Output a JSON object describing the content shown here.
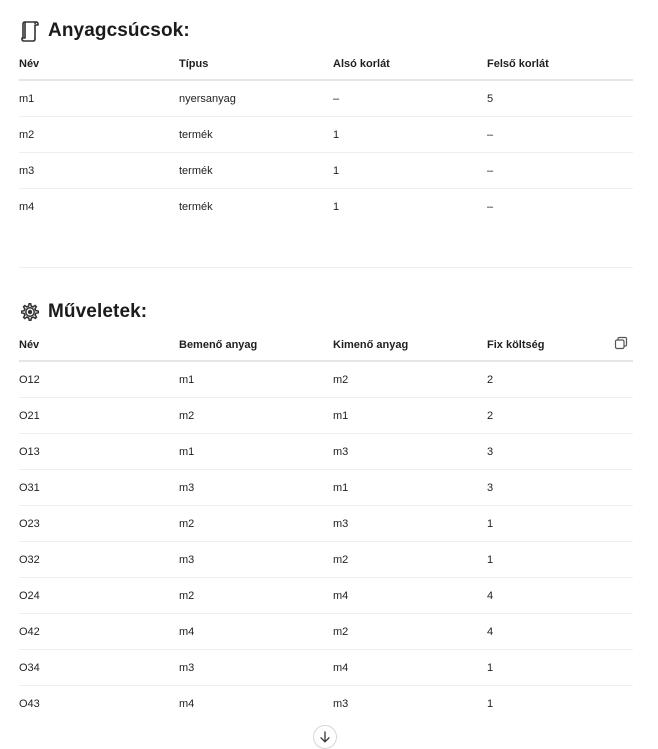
{
  "materials": {
    "title": "Anyagcsúcsok:",
    "icon": "scroll-icon",
    "headers": [
      "Név",
      "Típus",
      "Alsó korlát",
      "Felső korlát"
    ],
    "rows": [
      [
        "m1",
        "nyersanyag",
        "–",
        "5"
      ],
      [
        "m2",
        "termék",
        "1",
        "–"
      ],
      [
        "m3",
        "termék",
        "1",
        "–"
      ],
      [
        "m4",
        "termék",
        "1",
        "–"
      ]
    ]
  },
  "operations": {
    "title": "Műveletek:",
    "icon": "gear-icon",
    "copy_icon": "copy-icon",
    "headers": [
      "Név",
      "Bemenő anyag",
      "Kimenő anyag",
      "Fix költség"
    ],
    "rows": [
      [
        "O12",
        "m1",
        "m2",
        "2"
      ],
      [
        "O21",
        "m2",
        "m1",
        "2"
      ],
      [
        "O13",
        "m1",
        "m3",
        "3"
      ],
      [
        "O31",
        "m3",
        "m1",
        "3"
      ],
      [
        "O23",
        "m2",
        "m3",
        "1"
      ],
      [
        "O32",
        "m3",
        "m2",
        "1"
      ],
      [
        "O24",
        "m2",
        "m4",
        "4"
      ],
      [
        "O42",
        "m4",
        "m2",
        "4"
      ],
      [
        "O34",
        "m3",
        "m4",
        "1"
      ],
      [
        "O43",
        "m4",
        "m3",
        "1"
      ]
    ]
  },
  "scroll_down_icon": "arrow-down-icon"
}
